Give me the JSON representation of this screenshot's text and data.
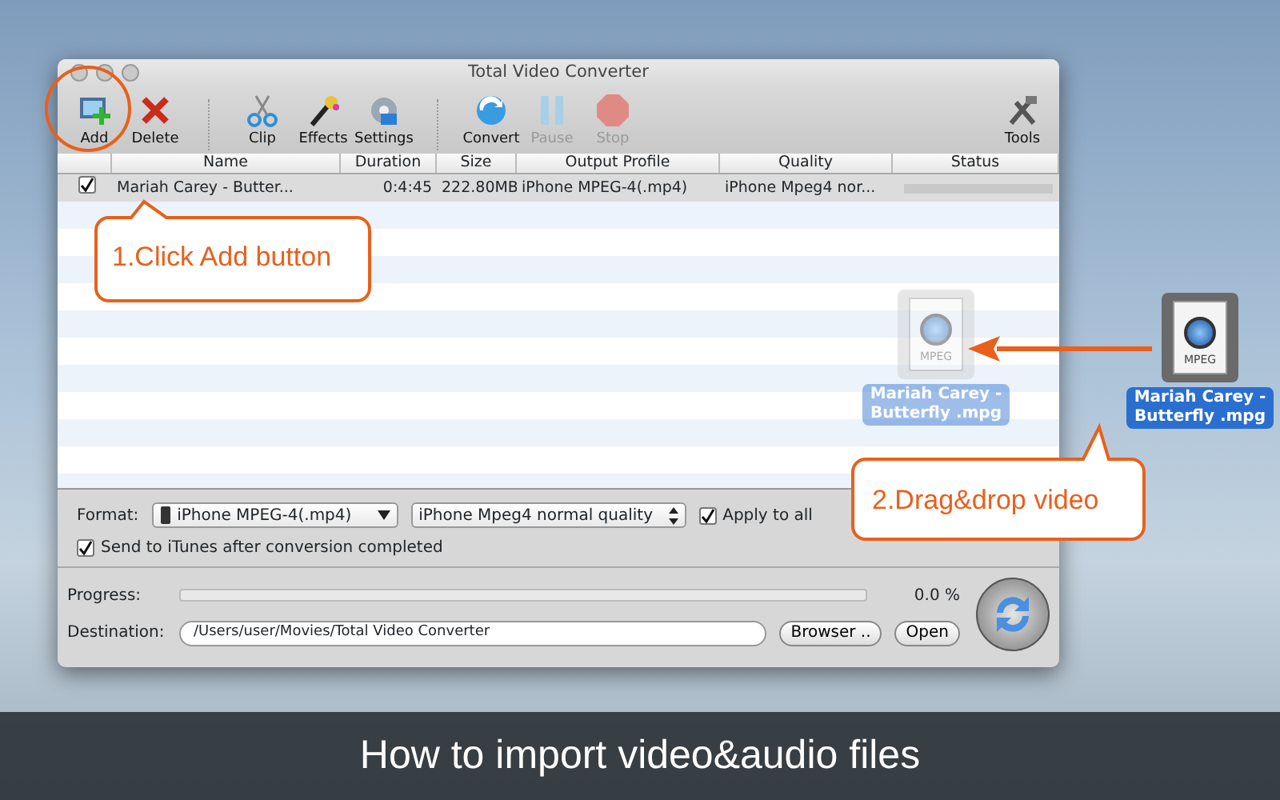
{
  "window": {
    "title": "Total Video Converter"
  },
  "toolbar": [
    {
      "label": "Add",
      "kind": "add",
      "disabled": false
    },
    {
      "label": "Delete",
      "kind": "delete",
      "disabled": false
    },
    {
      "label": "Clip",
      "kind": "clip",
      "disabled": false
    },
    {
      "label": "Effects",
      "kind": "effects",
      "disabled": false
    },
    {
      "label": "Settings",
      "kind": "settings",
      "disabled": false
    },
    {
      "label": "Convert",
      "kind": "convert",
      "disabled": false
    },
    {
      "label": "Pause",
      "kind": "pause",
      "disabled": true
    },
    {
      "label": "Stop",
      "kind": "stop",
      "disabled": true
    },
    {
      "label": "Tools",
      "kind": "tools",
      "disabled": false
    }
  ],
  "table": {
    "columns": [
      "Name",
      "Duration",
      "Size",
      "Output Profile",
      "Quality",
      "Status"
    ],
    "rows": [
      {
        "checked": true,
        "cells": [
          "Mariah Carey - Butter...",
          "0:4:45",
          "222.80MB",
          "iPhone MPEG-4(.mp4)",
          "iPhone Mpeg4 nor..."
        ]
      }
    ]
  },
  "format": {
    "label": "Format:",
    "profile": "iPhone MPEG-4(.mp4)",
    "quality": "iPhone Mpeg4 normal quality",
    "apply_all": {
      "label": "Apply to all",
      "checked": true
    }
  },
  "itunes": {
    "label": "Send to iTunes after conversion completed",
    "checked": true
  },
  "progress": {
    "label": "Progress:",
    "level": 0,
    "reading": "0.0 %"
  },
  "destination": {
    "label": "Destination:",
    "value": "/Users/user/Movies/Total Video Converter",
    "buttons": [
      "Browser ..",
      "Open"
    ]
  },
  "drag_files": [
    {
      "ghost": true,
      "icon_text": "MPEG",
      "name": "Mariah Carey - Butterfly .mpg"
    },
    {
      "ghost": false,
      "icon_text": "MPEG",
      "name": "Mariah Carey - Butterfly .mpg"
    }
  ],
  "callouts": [
    {
      "kind": "add",
      "text": "1.Click Add button"
    },
    {
      "kind": "drop",
      "text": "2.Drag&drop video"
    }
  ],
  "caption": "How to import video&audio files"
}
